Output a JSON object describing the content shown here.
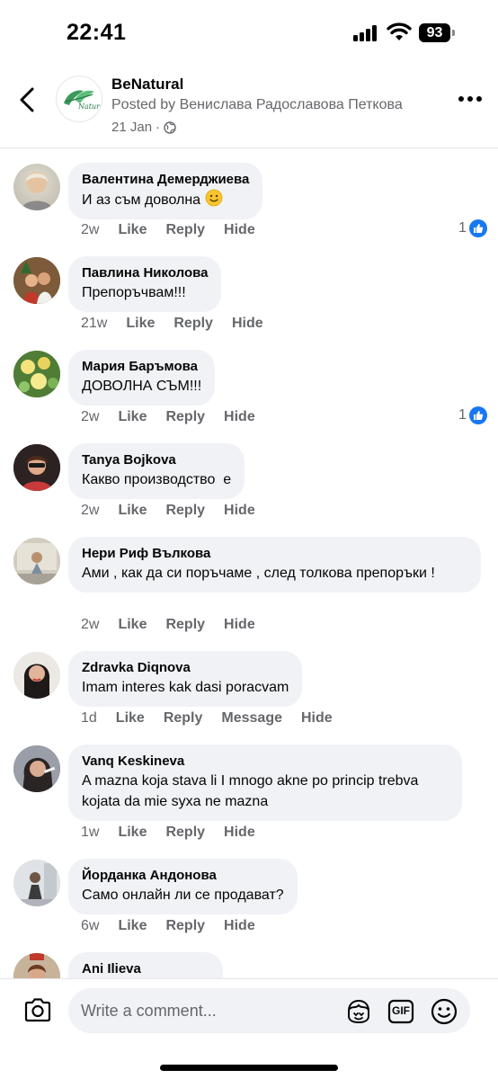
{
  "status_bar": {
    "time": "22:41",
    "battery": "93"
  },
  "header": {
    "page_name": "BeNatural",
    "posted_by": "Posted by Венислава Радославова Петкова",
    "date": "21 Jan",
    "logo_text": "Natural",
    "icons": {
      "back": "chevron-left-icon",
      "privacy": "globe-icon",
      "more": "more-horizontal-icon"
    }
  },
  "comments": [
    {
      "name": "Валентина Демерджиева",
      "text": "И аз съм доволна",
      "emoji": "slightly-smiling-face",
      "time": "2w",
      "actions": [
        "Like",
        "Reply",
        "Hide"
      ],
      "reactions": "1"
    },
    {
      "name": "Павлина Николова",
      "text": "Препоръчвам!!!",
      "time": "21w",
      "actions": [
        "Like",
        "Reply",
        "Hide"
      ]
    },
    {
      "name": "Мария Баръмова",
      "text": "ДОВОЛНА СЪМ!!!",
      "time": "2w",
      "actions": [
        "Like",
        "Reply",
        "Hide"
      ],
      "reactions": "1"
    },
    {
      "name": "Tanya Bojkova",
      "text": "Какво производство  е",
      "time": "2w",
      "actions": [
        "Like",
        "Reply",
        "Hide"
      ]
    },
    {
      "name": "Нери Риф Вълкова",
      "text": "Ами , как да си поръчаме , след толкова препоръки !",
      "time": "2w",
      "actions": [
        "Like",
        "Reply",
        "Hide"
      ]
    },
    {
      "name": "Zdravka Diqnova",
      "text": "Imam interes kak dasi poracvam",
      "time": "1d",
      "actions": [
        "Like",
        "Reply",
        "Message",
        "Hide"
      ]
    },
    {
      "name": "Vanq Keskineva",
      "text": "A mazna koja stava li I mnogo akne po princip trebva kojata da mie syxa ne mazna",
      "time": "1w",
      "actions": [
        "Like",
        "Reply",
        "Hide"
      ]
    },
    {
      "name": "Йорданка Андонова",
      "text": "Само онлайн ли се продават?",
      "time": "6w",
      "actions": [
        "Like",
        "Reply",
        "Hide"
      ]
    },
    {
      "name": "Ani Ilieva",
      "text": "",
      "time": "",
      "actions": []
    }
  ],
  "composer": {
    "placeholder": "Write a comment...",
    "gif_label": "GIF",
    "icons": {
      "camera": "camera-icon",
      "avatar_sticker": "avatar-sticker-icon",
      "gif": "gif-icon",
      "emoji": "emoji-icon"
    }
  },
  "colors": {
    "accent": "#1877f2",
    "bubble": "#f0f2f5",
    "secondary_text": "#65676b"
  }
}
